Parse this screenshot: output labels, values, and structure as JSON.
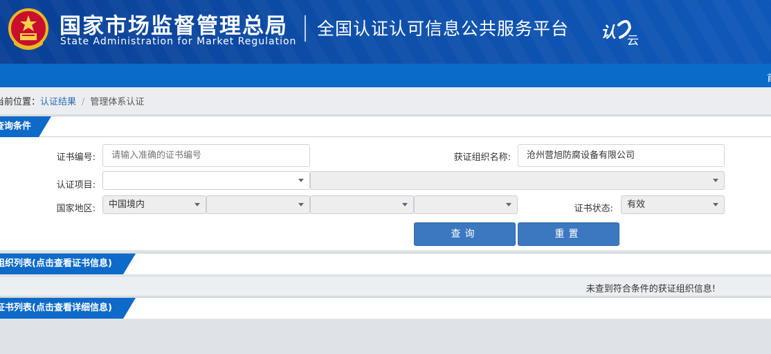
{
  "header": {
    "title_cn": "国家市场监督管理总局",
    "title_en": "State Administration  for  Market Regulation",
    "platform_name": "全国认证认可信息公共服务平台",
    "logo_text": "认云"
  },
  "breadcrumb": {
    "lead": "当前位置：",
    "link": "认证结果",
    "separator": "/",
    "current": "管理体系认证"
  },
  "query_panel": {
    "tab_label": "查询条件",
    "cert_no_label": "证书编号:",
    "cert_no_placeholder": "请输入准确的证书编号",
    "org_name_label": "获证组织名称:",
    "org_name_value": "沧州营旭防腐设备有限公司",
    "cert_item_label": "认证项目:",
    "cert_item_value": "",
    "cert_item_sub_value": "",
    "region_label": "国家地区:",
    "region_values": [
      "中国境内",
      "",
      "",
      ""
    ],
    "status_label": "证书状态:",
    "status_value": "有效",
    "search_button": "查询",
    "reset_button": "重置"
  },
  "org_list_panel": {
    "tab_label": "组织列表(点击查看证书信息)",
    "empty_message": "未查到符合条件的获证组织信息!"
  },
  "cert_list_panel": {
    "tab_label": "证书列表(点击查看详细信息)"
  },
  "colors": {
    "banner": "#0d4ea8",
    "navbar": "#0a6bc9",
    "tab": "#0d6ac8",
    "button": "#3c78bf",
    "link": "#2a6db3"
  }
}
